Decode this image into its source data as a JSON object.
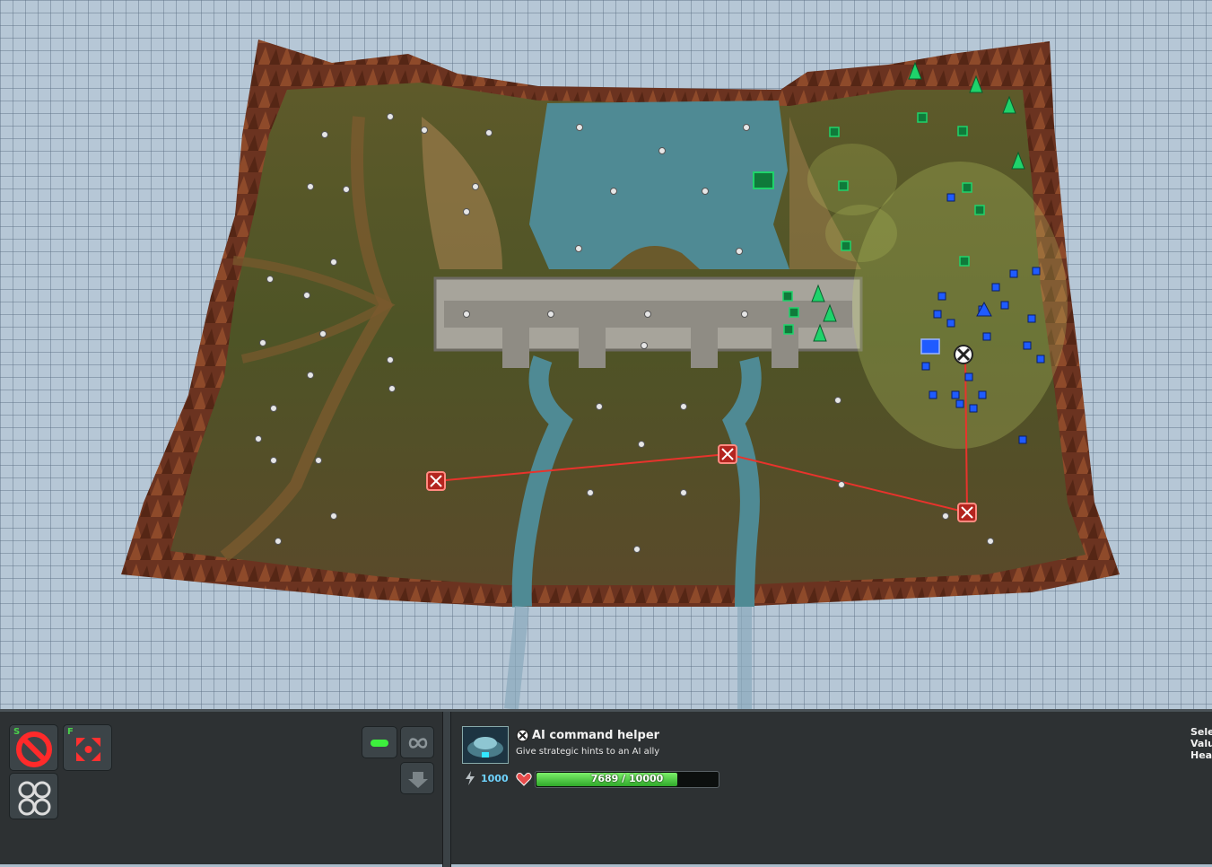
{
  "map": {
    "water_color": "#4f8a94",
    "terrain_color": "#5b5a2c",
    "cliff_color": "#7a3a22",
    "bridge_color": "#a7a49b",
    "red_team_color": "#e8332c",
    "green_team_color": "#1fd36b",
    "blue_team_color": "#1f5bff"
  },
  "command_panel": {
    "buttons": [
      {
        "name": "stop-button",
        "hotkey": "S",
        "icon": "stop-icon"
      },
      {
        "name": "scatter-button",
        "hotkey": "F",
        "icon": "scatter-icon"
      },
      {
        "name": "formation-button",
        "hotkey": "",
        "icon": "formation-icon"
      }
    ],
    "mode_buttons": [
      {
        "name": "fire-mode-button",
        "icon": "bullet-icon"
      },
      {
        "name": "repeat-button",
        "icon": "infinity-icon"
      },
      {
        "name": "unload-button",
        "icon": "arrow-down-icon"
      }
    ]
  },
  "selection": {
    "title": "AI command helper",
    "description": "Give strategic hints to an AI ally",
    "energy": "1000",
    "health_text": "7689 / 10000",
    "health_fraction": 0.7689
  },
  "right_info": {
    "lines": [
      "Sele",
      "Valu",
      "Hea"
    ]
  },
  "icons": {
    "energy": "lightning-icon",
    "health": "heart-icon",
    "title_badge": "command-badge-icon"
  }
}
